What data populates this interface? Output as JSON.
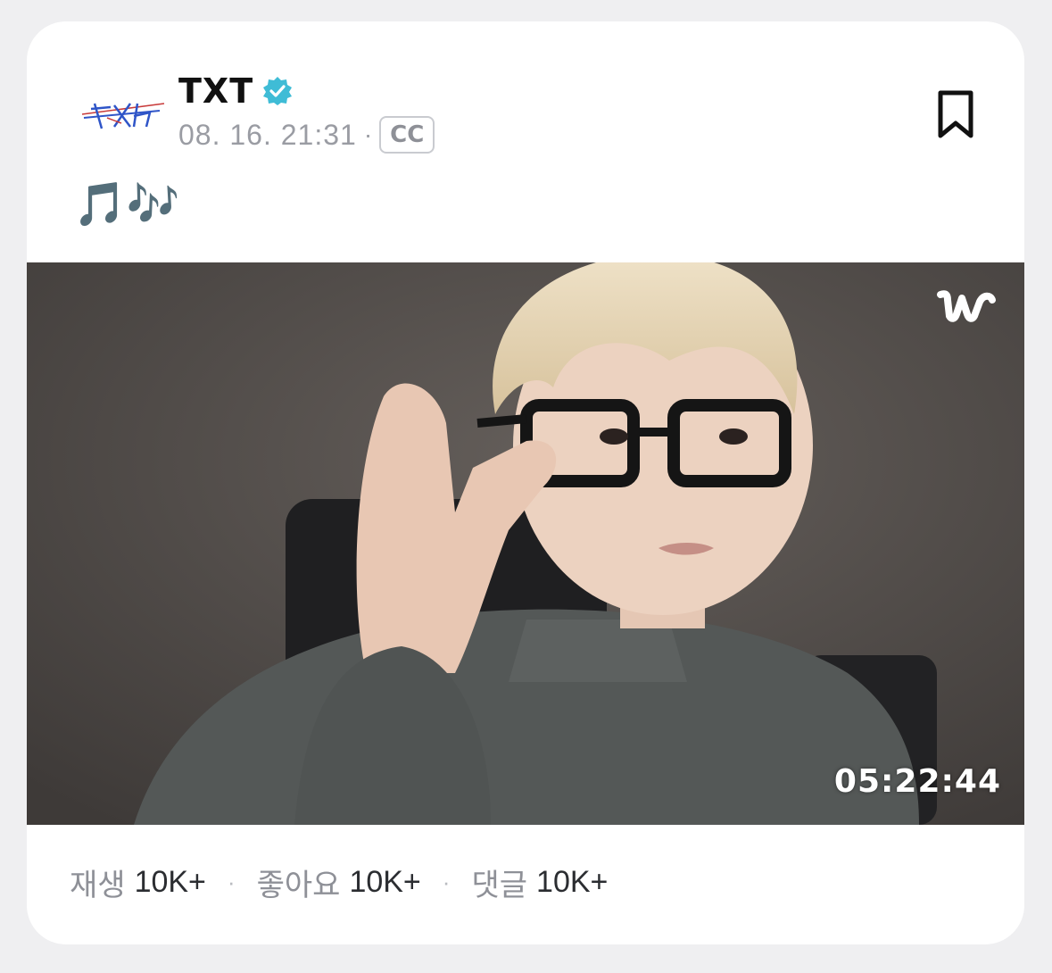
{
  "post": {
    "channel_name": "TXT",
    "verified": true,
    "timestamp": "08. 16. 21:31",
    "meta_separator": "·",
    "cc_label": "CC",
    "text": "🎵🎶",
    "avatar_logo_text": "TXT",
    "bookmark_icon": "bookmark-icon",
    "video": {
      "watermark": "w",
      "duration": "05:22:44"
    },
    "stats": [
      {
        "label": "재생",
        "value": "10K+"
      },
      {
        "label": "좋아요",
        "value": "10K+"
      },
      {
        "label": "댓글",
        "value": "10K+"
      }
    ],
    "stats_separator": "·"
  },
  "colors": {
    "verified": "#3fbcd6",
    "meta_text": "#9a9ca3",
    "background": "#efeff1"
  }
}
